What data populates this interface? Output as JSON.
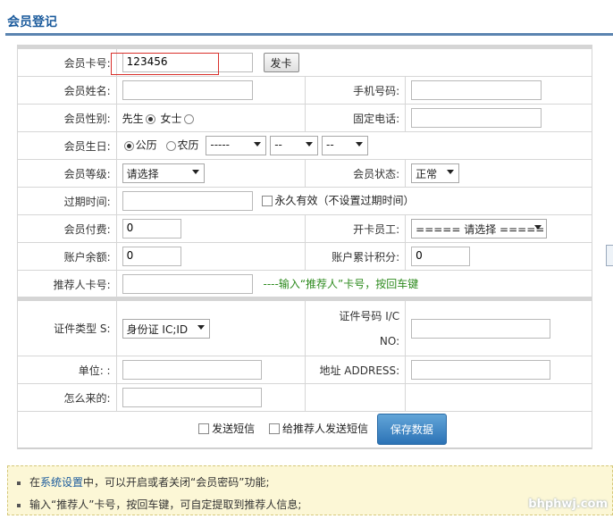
{
  "page": {
    "title": "会员登记",
    "watermark": "bhphwj.com"
  },
  "card": {
    "label": "会员卡号:",
    "value": "123456",
    "issue_button": "发卡"
  },
  "name": {
    "label": "会员姓名:",
    "value": ""
  },
  "mobile": {
    "label": "手机号码:",
    "value": ""
  },
  "gender": {
    "label": "会员性别:",
    "options": [
      "先生",
      "女士"
    ],
    "selected": "先生"
  },
  "phone": {
    "label": "固定电话:",
    "value": ""
  },
  "birthday": {
    "label": "会员生日:",
    "calendar_options": [
      "公历",
      "农历"
    ],
    "selected": "公历",
    "year_value": "-----",
    "month_value": "--",
    "day_value": "--"
  },
  "level": {
    "label": "会员等级:",
    "value": "请选择"
  },
  "status": {
    "label": "会员状态:",
    "value": "正常"
  },
  "expiry": {
    "label": "过期时间:",
    "value": "",
    "permanent_label": "永久有效（不设置过期时间）"
  },
  "payment": {
    "label": "会员付费:",
    "value": "0"
  },
  "staff": {
    "label": "开卡员工:",
    "value": "===== 请选择 ====="
  },
  "balance": {
    "label": "账户余额:",
    "value": "0"
  },
  "points": {
    "label": "账户累计积分:",
    "value": "0"
  },
  "referrer": {
    "label": "推荐人卡号:",
    "value": "",
    "hint": "----输入“推荐人”卡号，按回车键"
  },
  "id_type": {
    "label": "证件类型 S:",
    "value": "身份证 IC;ID"
  },
  "id_number": {
    "label_line1": "证件号码 I/C",
    "label_line2": "NO:",
    "value": ""
  },
  "unit": {
    "label": "单位: :",
    "value": ""
  },
  "address": {
    "label": "地址 ADDRESS:",
    "value": ""
  },
  "source": {
    "label": "怎么来的:",
    "value": ""
  },
  "actions": {
    "send_sms": "发送短信",
    "send_sms_referrer": "给推荐人发送短信",
    "save": "保存数据"
  },
  "notes": {
    "n1_prefix": "在",
    "n1_link": "系统设置",
    "n1_suffix": "中，可以开启或者关闭“会员密码”功能;",
    "n2": "输入“推荐人”卡号，按回车键，可自定提取到推荐人信息;"
  },
  "colors": {
    "title": "#1a5a9c",
    "accent_bar": "#5b84b0",
    "highlight": "#d9302b",
    "hint_green": "#2e8b1f",
    "save_button": "#2c73b6",
    "notes_bg": "#fcf7d6"
  }
}
